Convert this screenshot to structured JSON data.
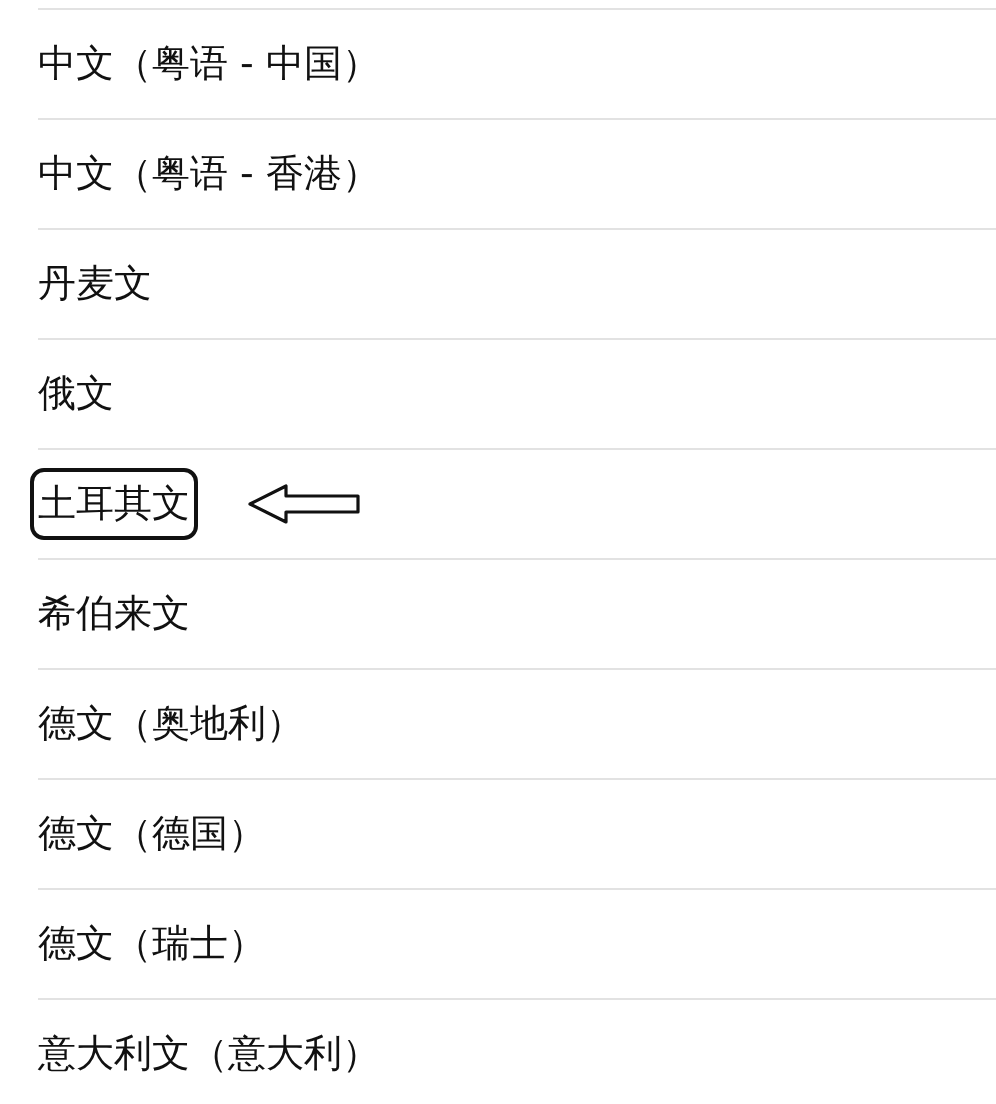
{
  "languages": [
    {
      "label": "中文（粤语 - 中国）",
      "highlighted": false
    },
    {
      "label": "中文（粤语 - 香港）",
      "highlighted": false
    },
    {
      "label": "丹麦文",
      "highlighted": false
    },
    {
      "label": "俄文",
      "highlighted": false
    },
    {
      "label": "土耳其文",
      "highlighted": true
    },
    {
      "label": "希伯来文",
      "highlighted": false
    },
    {
      "label": "德文（奥地利）",
      "highlighted": false
    },
    {
      "label": "德文（德国）",
      "highlighted": false
    },
    {
      "label": "德文（瑞士）",
      "highlighted": false
    },
    {
      "label": "意大利文（意大利）",
      "highlighted": false
    }
  ]
}
